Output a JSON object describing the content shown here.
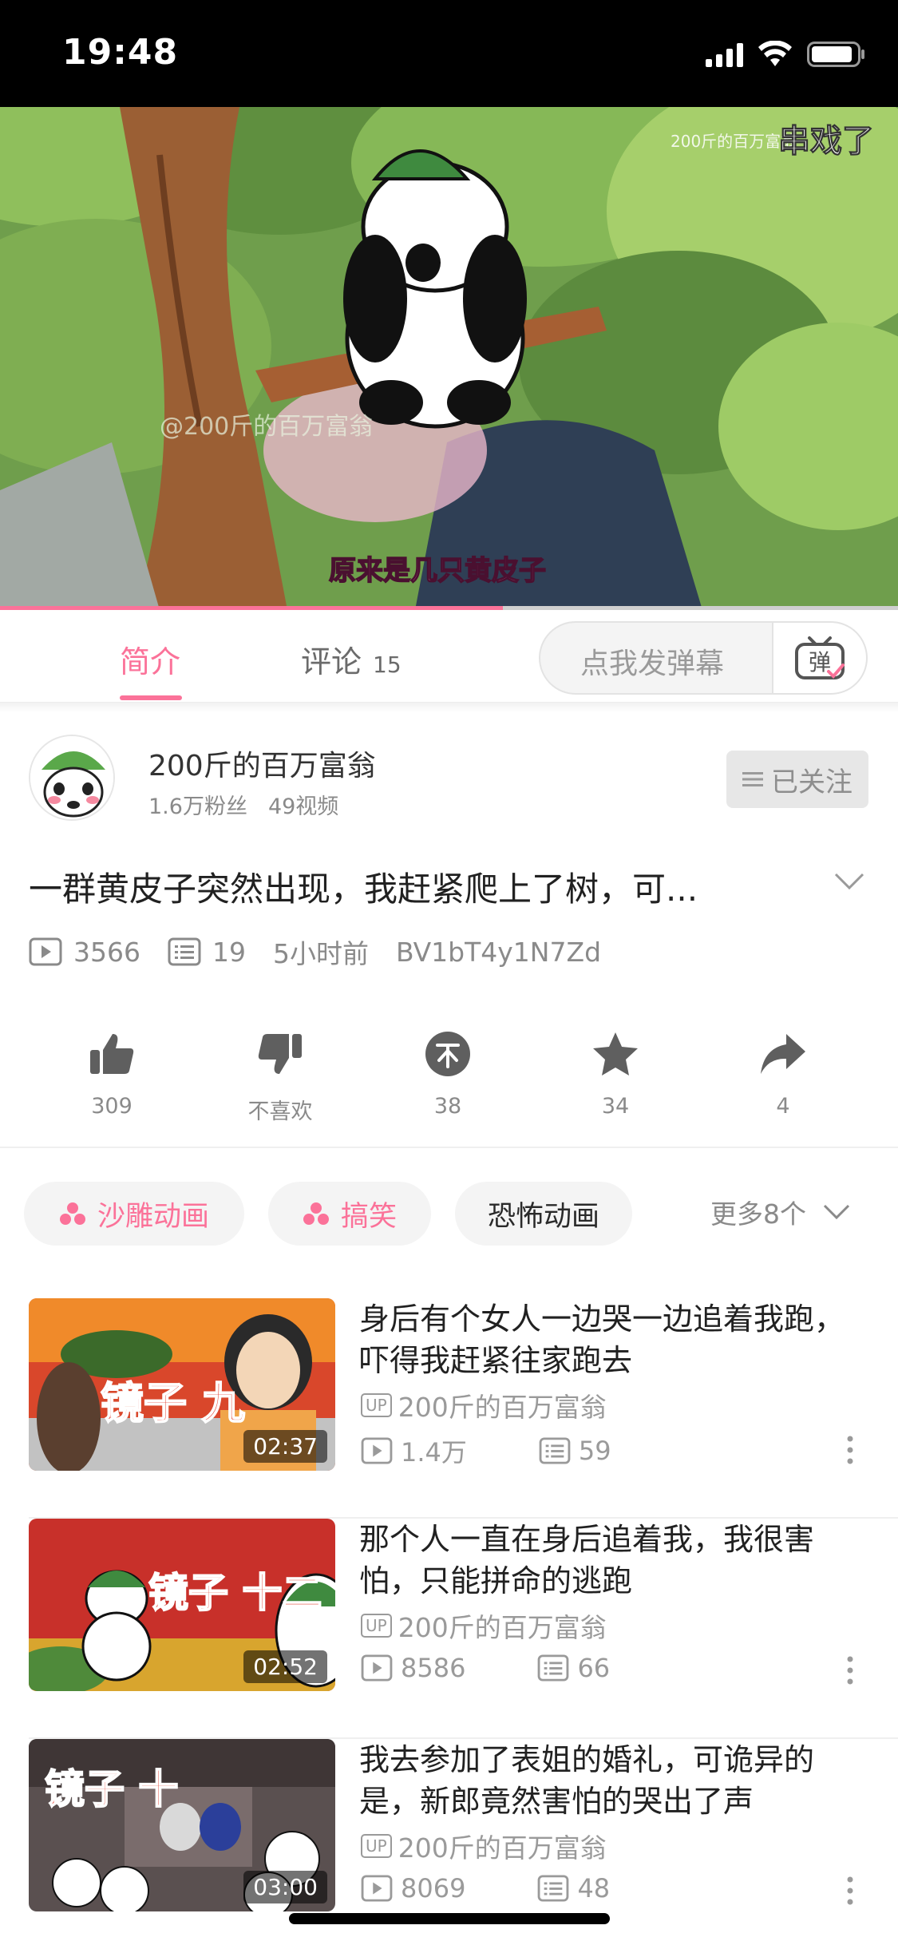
{
  "status_bar": {
    "time": "19:48"
  },
  "video": {
    "watermark": "200斤的百万富翁",
    "corner_danmaku": "串戏了",
    "subtitle": "原来是几只黄皮子",
    "watermark_center": "@200斤的百万富翁",
    "progress_fraction": 0.56
  },
  "tabs": {
    "intro": "简介",
    "comments": "评论",
    "comments_count": "15",
    "danmaku_placeholder": "点我发弹幕",
    "danmaku_button": "弹"
  },
  "uploader": {
    "name": "200斤的百万富翁",
    "fans": "1.6万粉丝",
    "videos": "49视频",
    "follow_label": "已关注"
  },
  "video_info": {
    "title": "一群黄皮子突然出现，我赶紧爬上了树，可...",
    "views": "3566",
    "danmaku_count": "19",
    "time_ago": "5小时前",
    "bvid": "BV1bT4y1N7Zd"
  },
  "actions": {
    "like": "309",
    "dislike": "不喜欢",
    "coin": "38",
    "favorite": "34",
    "share": "4"
  },
  "tags": {
    "items": [
      "沙雕动画",
      "搞笑",
      "恐怖动画"
    ],
    "more": "更多8个"
  },
  "related": [
    {
      "title": "身后有个女人一边哭一边追着我跑，吓得我赶紧往家跑去",
      "up_badge": "UP",
      "author": "200斤的百万富翁",
      "views": "1.4万",
      "danmaku": "59",
      "duration": "02:37",
      "thumb_text": "镜子 九"
    },
    {
      "title": "那个人一直在身后追着我，我很害怕，只能拼命的逃跑",
      "up_badge": "UP",
      "author": "200斤的百万富翁",
      "views": "8586",
      "danmaku": "66",
      "duration": "02:52",
      "thumb_text": "镜子 十二"
    },
    {
      "title": "我去参加了表姐的婚礼，可诡异的是，新郎竟然害怕的哭出了声",
      "up_badge": "UP",
      "author": "200斤的百万富翁",
      "views": "8069",
      "danmaku": "48",
      "duration": "03:00",
      "thumb_text": "镜子 十"
    }
  ],
  "colors": {
    "accent": "#fb7299",
    "text_primary": "#212121",
    "text_secondary": "#8a8a8a"
  }
}
